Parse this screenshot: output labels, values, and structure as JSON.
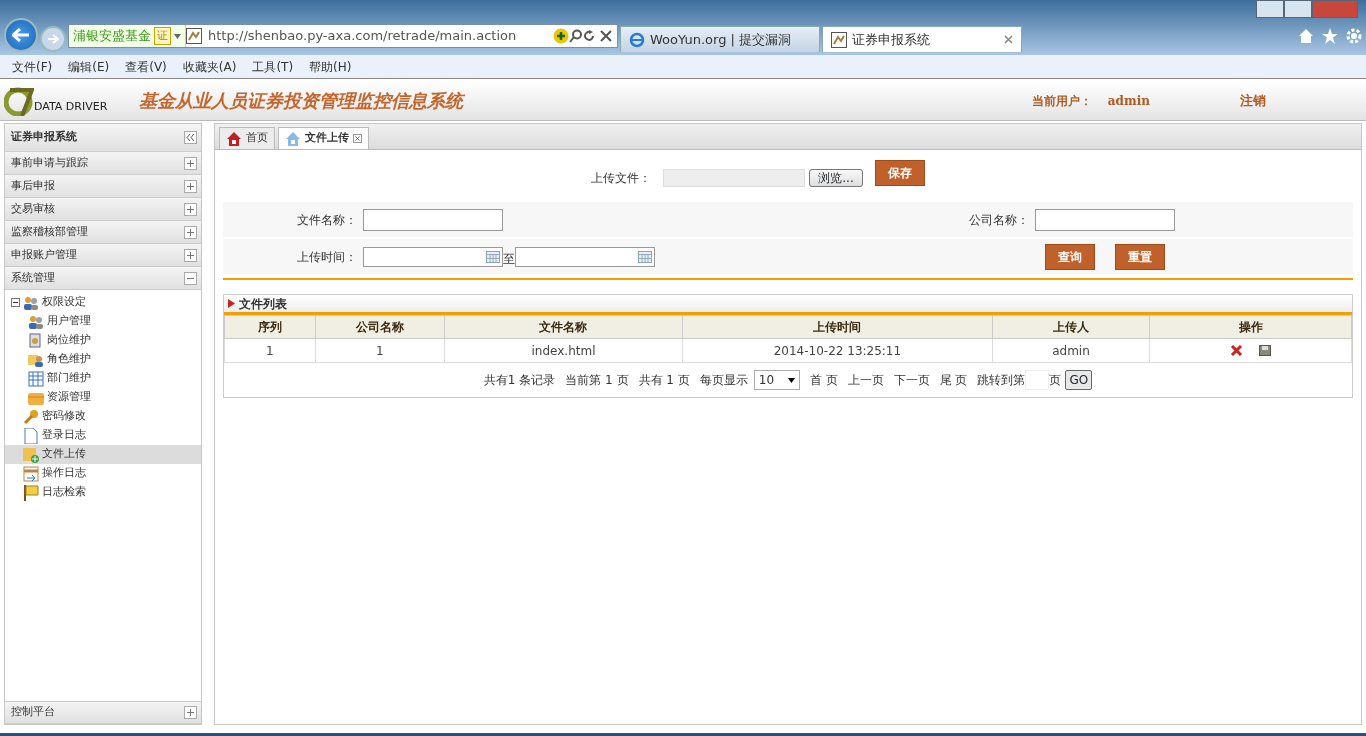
{
  "browser": {
    "site_name": "浦银安盛基金",
    "site_badge": "证",
    "url": "http://shenbao.py-axa.com/retrade/main.action",
    "tabs": [
      {
        "title": "WooYun.org | 提交漏洞",
        "selected": false
      },
      {
        "title": "证券申报系统",
        "selected": true
      }
    ],
    "menu": [
      "文件(F)",
      "编辑(E)",
      "查看(V)",
      "收藏夹(A)",
      "工具(T)",
      "帮助(H)"
    ]
  },
  "app_header": {
    "logo_text": "DATA DRIVER",
    "title": "基金从业人员证券投资管理监控信息系统",
    "user_label": "当前用户：",
    "user": "admin",
    "logout": "注销"
  },
  "sidebar": {
    "title": "证券申报系统",
    "sections": [
      {
        "label": "事前申请与跟踪",
        "expanded": false
      },
      {
        "label": "事后申报",
        "expanded": false
      },
      {
        "label": "交易审核",
        "expanded": false
      },
      {
        "label": "监察稽核部管理",
        "expanded": false
      },
      {
        "label": "申报账户管理",
        "expanded": false
      },
      {
        "label": "系统管理",
        "expanded": true,
        "tree": [
          {
            "label": "权限设定",
            "kind": "users",
            "selected": false,
            "expanded": true,
            "children": [
              {
                "label": "用户管理",
                "kind": "users",
                "selected": false
              },
              {
                "label": "岗位维护",
                "kind": "post",
                "selected": false
              },
              {
                "label": "角色维护",
                "kind": "role",
                "selected": false
              },
              {
                "label": "部门维护",
                "kind": "grid",
                "selected": false
              },
              {
                "label": "资源管理",
                "kind": "box",
                "selected": false
              }
            ]
          },
          {
            "label": "密码修改",
            "kind": "key",
            "selected": false
          },
          {
            "label": "登录日志",
            "kind": "doc",
            "selected": false
          },
          {
            "label": "文件上传",
            "kind": "upload",
            "selected": true
          },
          {
            "label": "操作日志",
            "kind": "log",
            "selected": false
          },
          {
            "label": "日志检索",
            "kind": "flag",
            "selected": false
          }
        ]
      }
    ],
    "footer": {
      "label": "控制平台",
      "expanded": false
    }
  },
  "content_tabs": [
    {
      "label": "首页",
      "kind": "home",
      "selected": false,
      "closable": false
    },
    {
      "label": "文件上传",
      "kind": "house",
      "selected": true,
      "closable": true
    }
  ],
  "upload": {
    "label": "上传文件：",
    "browse": "浏览...",
    "save": "保存"
  },
  "filters": {
    "file_name_label": "文件名称：",
    "company_label": "公司名称：",
    "time_label": "上传时间：",
    "separator": "至",
    "buttons": [
      "查询",
      "重置"
    ]
  },
  "file_list": {
    "title": "文件列表",
    "columns": [
      "序列",
      "公司名称",
      "文件名称",
      "上传时间",
      "上传人",
      "操作"
    ],
    "rows": [
      {
        "cells": [
          "1",
          "1",
          "index.html",
          "2014-10-22 13:25:11",
          "admin"
        ]
      }
    ]
  },
  "pager": {
    "texts": [
      "共有1 条记录",
      "当前第 1 页",
      "共有 1 页",
      "每页显示"
    ],
    "page_size": "10",
    "links": [
      "首 页",
      "上一页",
      "下一页",
      "尾 页"
    ],
    "jump_label": "跳转到第",
    "jump_suffix": "页",
    "go": "GO"
  }
}
